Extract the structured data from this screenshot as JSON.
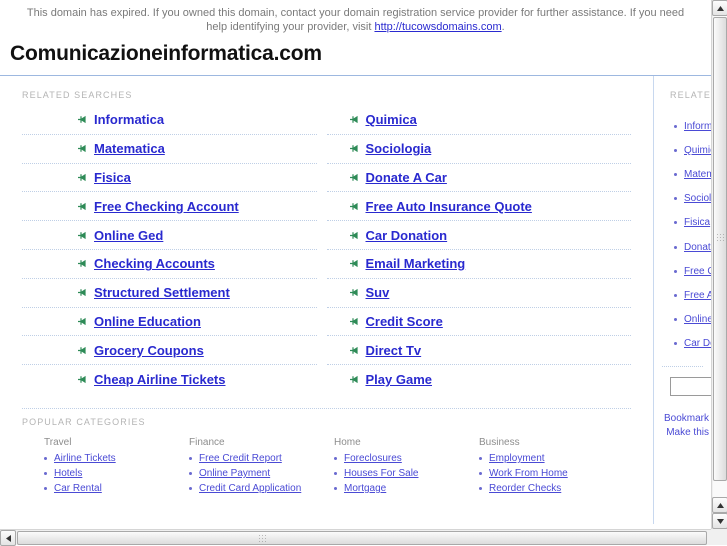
{
  "notice": {
    "text_before": "This domain has expired. If you owned this domain, contact your domain registration service provider for further assistance. If you need help identifying your provider, visit ",
    "link_text": "http://tucowsdomains.com",
    "text_after": "."
  },
  "header": {
    "domain_title": "Comunicazioneinformatica.com"
  },
  "main": {
    "related_searches_label": "RELATED SEARCHES",
    "left_column": [
      "Informatica",
      "Matematica",
      "Fisica",
      "Free Checking Account",
      "Online Ged",
      "Checking Accounts",
      "Structured Settlement",
      "Online Education",
      "Grocery Coupons",
      "Cheap Airline Tickets"
    ],
    "right_column": [
      "Quimica",
      "Sociologia",
      "Donate A Car",
      "Free Auto Insurance Quote",
      "Car Donation",
      "Email Marketing",
      "Suv",
      "Credit Score",
      "Direct Tv",
      "Play Game"
    ],
    "popular_categories_label": "POPULAR CATEGORIES",
    "categories": [
      {
        "heading": "Travel",
        "links": [
          "Airline Tickets",
          "Hotels",
          "Car Rental"
        ]
      },
      {
        "heading": "Finance",
        "links": [
          "Free Credit Report",
          "Online Payment",
          "Credit Card Application"
        ]
      },
      {
        "heading": "Home",
        "links": [
          "Foreclosures",
          "Houses For Sale",
          "Mortgage"
        ]
      },
      {
        "heading": "Business",
        "links": [
          "Employment",
          "Work From Home",
          "Reorder Checks"
        ]
      }
    ]
  },
  "sidebar": {
    "label": "RELATED",
    "links": [
      "Informatica",
      "Quimica",
      "Matematica",
      "Sociologia",
      "Fisica",
      "Donate A Car",
      "Free Checking Account",
      "Free Auto Insurance Quote",
      "Online Ged",
      "Car Donation"
    ],
    "search_value": "",
    "search_placeholder": "",
    "footer_line1": "Bookmark",
    "footer_line2": "Make this"
  },
  "colors": {
    "link": "#2929cf",
    "secondary_link": "#4a4ad5",
    "arrow": "#2e8b57",
    "label": "#b4b4b4",
    "rule": "#9db8e0",
    "dotted": "#bfcfe6"
  },
  "scrollbars": {
    "vertical_up": "▲",
    "vertical_down": "▼",
    "horizontal_left": "◀"
  }
}
